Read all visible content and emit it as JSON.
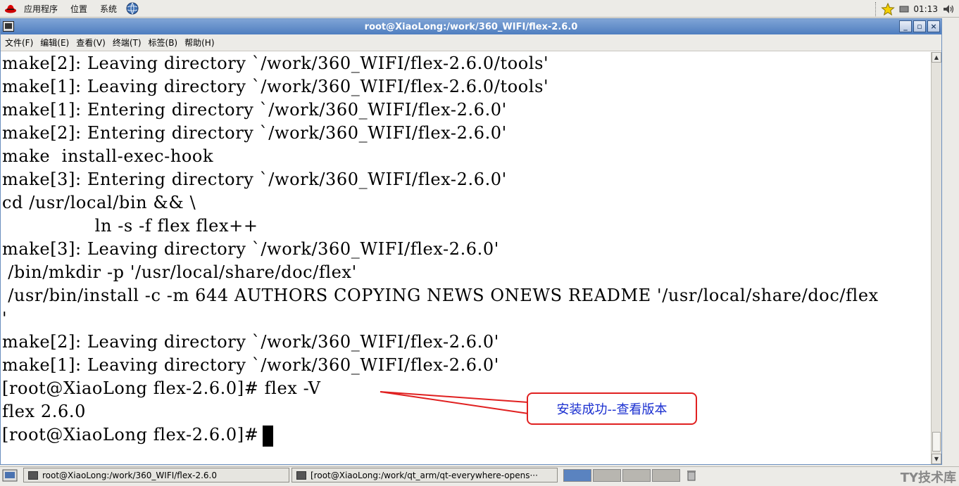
{
  "top_panel": {
    "menus": [
      "应用程序",
      "位置",
      "系统"
    ],
    "clock": "01:13"
  },
  "window": {
    "title": "root@XiaoLong:/work/360_WIFI/flex-2.6.0",
    "controls": [
      "_",
      "▫",
      "×"
    ],
    "menubar": [
      "文件(F)",
      "编辑(E)",
      "查看(V)",
      "终端(T)",
      "标签(B)",
      "帮助(H)"
    ]
  },
  "terminal": {
    "lines": [
      "make[2]: Leaving directory `/work/360_WIFI/flex-2.6.0/tools'",
      "make[1]: Leaving directory `/work/360_WIFI/flex-2.6.0/tools'",
      "make[1]: Entering directory `/work/360_WIFI/flex-2.6.0'",
      "make[2]: Entering directory `/work/360_WIFI/flex-2.6.0'",
      "make  install-exec-hook",
      "make[3]: Entering directory `/work/360_WIFI/flex-2.6.0'",
      "cd /usr/local/bin && \\",
      "                ln -s -f flex flex++",
      "make[3]: Leaving directory `/work/360_WIFI/flex-2.6.0'",
      " /bin/mkdir -p '/usr/local/share/doc/flex'",
      " /usr/bin/install -c -m 644 AUTHORS COPYING NEWS ONEWS README '/usr/local/share/doc/flex",
      "'",
      "make[2]: Leaving directory `/work/360_WIFI/flex-2.6.0'",
      "make[1]: Leaving directory `/work/360_WIFI/flex-2.6.0'",
      "[root@XiaoLong flex-2.6.0]# flex -V",
      "flex 2.6.0"
    ],
    "prompt": "[root@XiaoLong flex-2.6.0]#"
  },
  "annotation": {
    "text": "安装成功--查看版本",
    "border_color": "#e02020",
    "text_color": "#1a2fd0"
  },
  "taskbar": {
    "tasks": [
      "root@XiaoLong:/work/360_WIFI/flex-2.6.0",
      "[root@XiaoLong:/work/qt_arm/qt-everywhere-opens···"
    ]
  },
  "watermark": "TY技术库"
}
